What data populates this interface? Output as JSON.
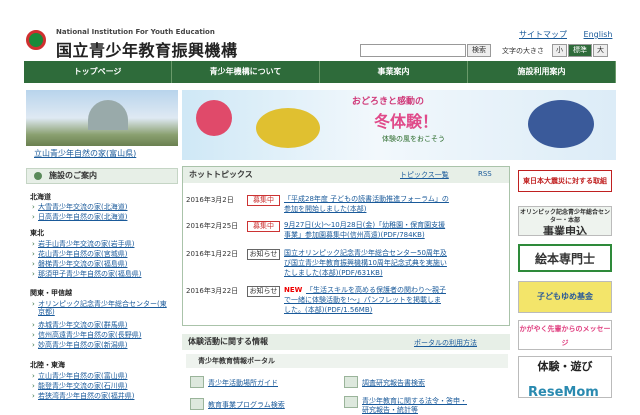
{
  "header": {
    "logo_en": "National Institution For Youth Education",
    "logo_jp": "国立青少年教育振興機構",
    "sitemap": "サイトマップ",
    "english": "English",
    "search_button": "検索",
    "font_size_label": "文字の大きさ",
    "font_sizes": [
      "小",
      "標準",
      "大"
    ]
  },
  "nav": [
    "トップページ",
    "青少年機構について",
    "事業案内",
    "施設利用案内"
  ],
  "photo_caption": "立山青少年自然の家(富山県)",
  "banner": {
    "line1": "おどろきと感動の",
    "line2": "冬体験！",
    "line3": "体験の風をおこそう"
  },
  "sidebar": {
    "heading": "施設のご案内",
    "regions": [
      {
        "name": "北海道",
        "items": [
          "大雪青少年交流の家(北海道)",
          "日高青少年自然の家(北海道)"
        ]
      },
      {
        "name": "東北",
        "items": [
          "岩手山青少年交流の家(岩手県)",
          "花山青少年自然の家(宮城県)",
          "磐梯青少年交流の家(福島県)",
          "那須甲子青少年自然の家(福島県)"
        ]
      },
      {
        "name": "関東・甲信越",
        "items": [
          "オリンピック記念青少年総合センター(東京都)",
          "赤城青少年交流の家(群馬県)",
          "信州高遠青少年自然の家(長野県)",
          "妙高青少年自然の家(新潟県)"
        ]
      },
      {
        "name": "北陸・東海",
        "items": [
          "立山青少年自然の家(富山県)",
          "能登青少年交流の家(石川県)",
          "若狭湾青少年自然の家(福井県)"
        ]
      }
    ]
  },
  "topics": {
    "heading": "ホットトピックス",
    "list_link": "トピックス一覧",
    "rss": "RSS",
    "items": [
      {
        "date": "2016年3月2日",
        "badge": "募集中",
        "text": [
          "「平成28年度 子どもの読書活動推進フォーラム」の",
          "参加を開始しました(本部)"
        ]
      },
      {
        "date": "2016年2月25日",
        "badge": "募集中",
        "text": [
          "9月27日(火)～10月28日(金)「幼稚園・保育園支援",
          "事業」参加園募集中(信州高遠)(PDF/784KB)"
        ]
      },
      {
        "date": "2016年1月22日",
        "badge": "お知らせ",
        "text": [
          "国立オリンピック記念青少年総合センター50周年及",
          "び国立青少年教育振興機構10周年記念式典を実施い",
          "たしました(本部)(PDF/631KB)"
        ]
      },
      {
        "date": "2016年3月22日",
        "badge": "お知らせ",
        "new": "NEW",
        "text": [
          "「生活スキルを高める保護者の関わり～親子",
          "で一緒に体験活動を!～」パンフレットを掲載しま",
          "した。(本部)(PDF/1.56MB)"
        ]
      }
    ]
  },
  "experience": {
    "heading": "体験活動に関する情報",
    "portal_link": "ポータルの利用方法",
    "sub_heading": "青少年教育情報ポータル",
    "links": [
      "青少年活動場所ガイド",
      "調査研究報告書検索",
      "教育事業プログラム検索",
      "青少年教育に関する法令・答申・",
      "研究報告・統計等"
    ]
  },
  "right_banners": [
    "東日本大震災に対する取組",
    "オリンピック記念青少年総合センター・本部",
    "事業申込",
    "絵本専門士",
    "子どもゆめ基金",
    "かがやく先輩からのメッセージ",
    "体験・遊び",
    "ReseMom"
  ]
}
